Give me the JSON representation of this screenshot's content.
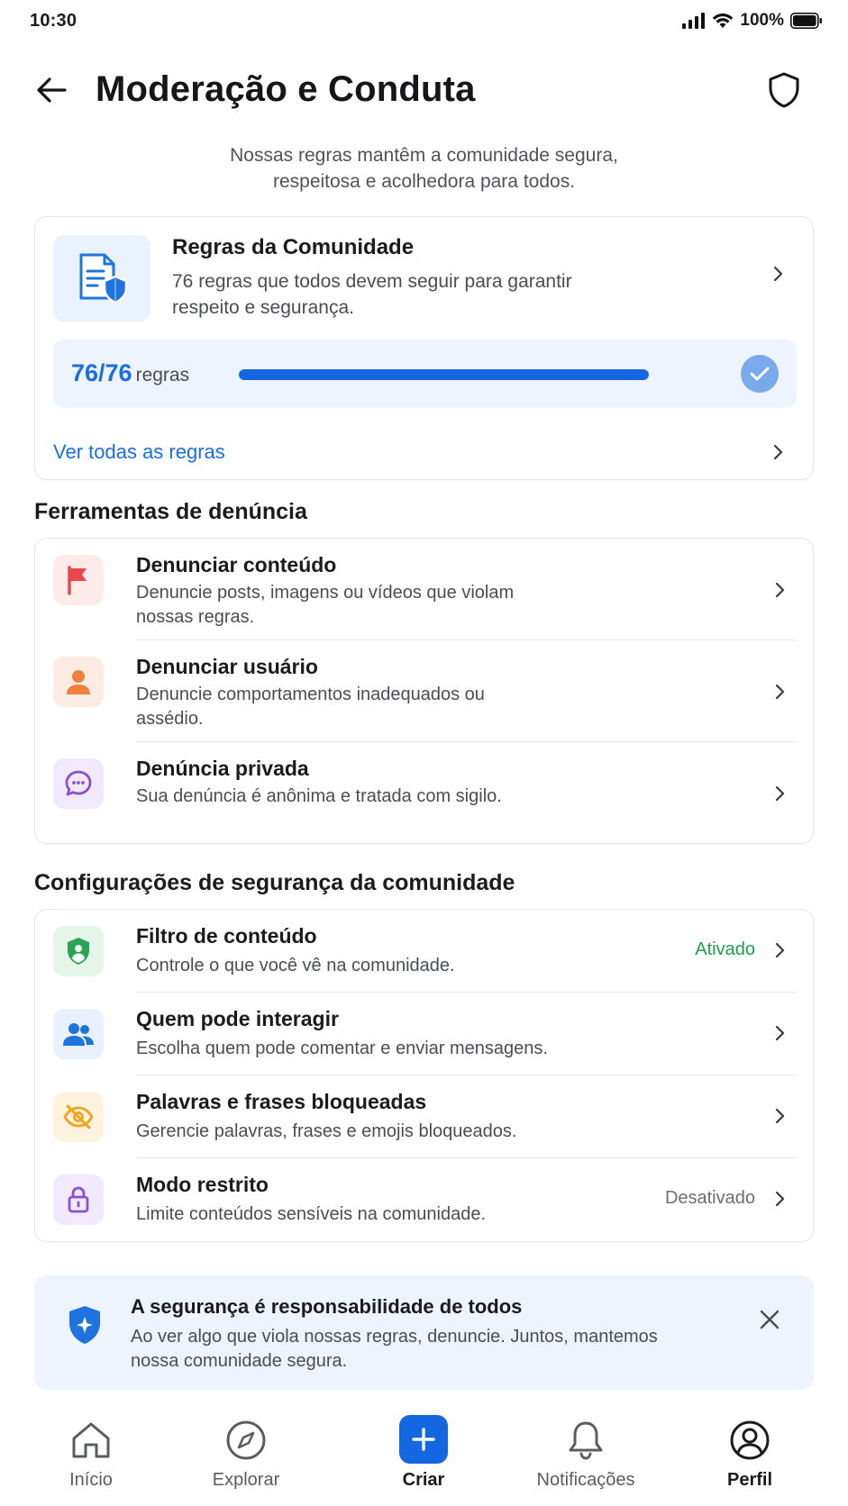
{
  "status_bar": {
    "time": "10:30",
    "battery": "100%"
  },
  "header": {
    "title": "Moderação e Conduta"
  },
  "subtitle": "Nossas regras mantêm a comunidade segura, respeitosa e acolhedora para todos.",
  "rules_card": {
    "title": "Regras da Comunidade",
    "description": "76 regras que todos devem seguir para garantir respeito e segurança.",
    "progress_count": "76/76",
    "progress_unit": "regras",
    "progress_fraction": 1.0,
    "see_all": "Ver todas as regras"
  },
  "report_tools": {
    "title": "Ferramentas de denúncia",
    "items": [
      {
        "title": "Denunciar conteúdo",
        "description": "Denuncie posts, imagens ou vídeos que violam nossas regras.",
        "icon": "flag-icon"
      },
      {
        "title": "Denunciar usuário",
        "description": "Denuncie comportamentos inadequados ou assédio.",
        "icon": "user-icon"
      },
      {
        "title": "Denúncia privada",
        "description": "Sua denúncia é anônima e tratada com sigilo.",
        "icon": "chat-bubble-icon"
      }
    ]
  },
  "safety_settings": {
    "title": "Configurações de segurança da comunidade",
    "items": [
      {
        "title": "Filtro de conteúdo",
        "description": "Controle o que você vê na comunidade.",
        "status": "Ativado",
        "icon": "shield-user-icon"
      },
      {
        "title": "Quem pode interagir",
        "description": "Escolha quem pode comentar e enviar mensagens.",
        "status": "",
        "icon": "people-icon"
      },
      {
        "title": "Palavras e frases bloqueadas",
        "description": "Gerencie palavras, frases e emojis bloqueados.",
        "status": "",
        "icon": "eye-off-icon"
      },
      {
        "title": "Modo restrito",
        "description": "Limite conteúdos sensíveis na comunidade.",
        "status": "Desativado",
        "icon": "lock-icon"
      }
    ]
  },
  "banner": {
    "title": "A segurança é responsabilidade de todos",
    "description": "Ao ver algo que viola nossas regras, denuncie. Juntos, mantemos nossa comunidade segura."
  },
  "nav": {
    "items": [
      {
        "label": "Início"
      },
      {
        "label": "Explorar"
      },
      {
        "label": "Criar"
      },
      {
        "label": "Notificações"
      },
      {
        "label": "Perfil"
      }
    ],
    "active": "Perfil"
  },
  "colors": {
    "accent": "#1467e0",
    "active_green": "#1e9e4a",
    "inactive_gray": "#6b6d72"
  }
}
